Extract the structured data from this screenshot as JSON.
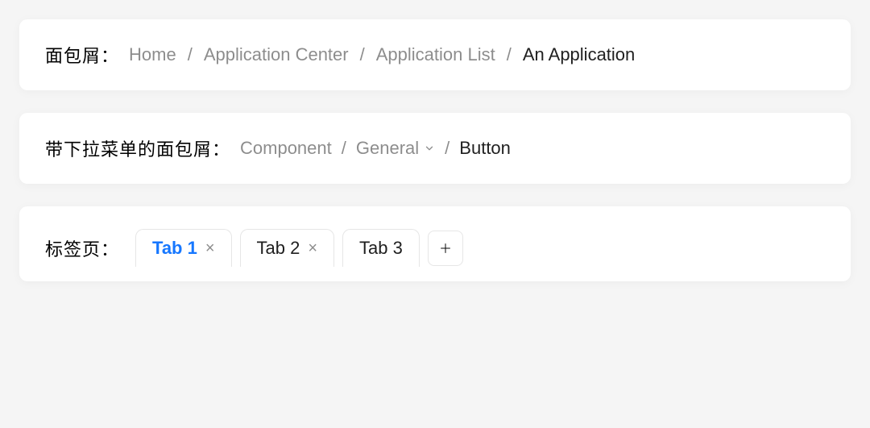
{
  "breadcrumb1": {
    "label": "面包屑：",
    "items": [
      {
        "text": "Home",
        "current": false
      },
      {
        "text": "Application Center",
        "current": false
      },
      {
        "text": "Application List",
        "current": false
      },
      {
        "text": "An Application",
        "current": true
      }
    ],
    "separator": "/"
  },
  "breadcrumb2": {
    "label": "带下拉菜单的面包屑：",
    "items": [
      {
        "text": "Component",
        "current": false,
        "dropdown": false
      },
      {
        "text": "General",
        "current": false,
        "dropdown": true
      },
      {
        "text": "Button",
        "current": true,
        "dropdown": false
      }
    ],
    "separator": "/"
  },
  "tabs": {
    "label": "标签页：",
    "items": [
      {
        "text": "Tab 1",
        "active": true,
        "closable": true
      },
      {
        "text": "Tab 2",
        "active": false,
        "closable": true
      },
      {
        "text": "Tab 3",
        "active": false,
        "closable": false
      }
    ],
    "close_glyph": "×",
    "add_glyph": "+"
  }
}
